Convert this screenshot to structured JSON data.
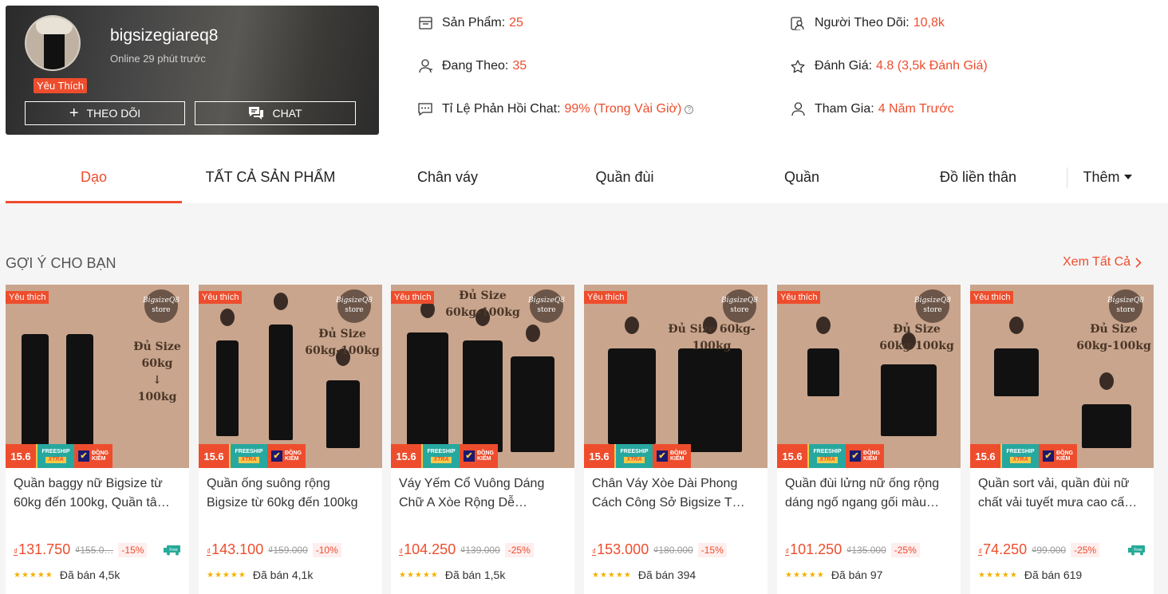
{
  "shop": {
    "name": "bigsizegiareq8",
    "online": "Online 29 phút trước",
    "badge": "Yêu Thích",
    "follow_label": "THEO DÕI",
    "chat_label": "CHAT"
  },
  "stats": {
    "products_label": "Sản Phẩm:",
    "products_value": "25",
    "following_label": "Đang Theo:",
    "following_value": "35",
    "response_label": "Tỉ Lệ Phản Hồi Chat:",
    "response_value": "99% (Trong Vài Giờ)",
    "followers_label": "Người Theo Dõi:",
    "followers_value": "10,8k",
    "rating_label": "Đánh Giá:",
    "rating_value": "4.8 (3,5k Đánh Giá)",
    "joined_label": "Tham Gia:",
    "joined_value": "4 Năm Trước"
  },
  "tabs": [
    {
      "label": "Dạo",
      "active": true
    },
    {
      "label": "TẤT CẢ SẢN PHẨM"
    },
    {
      "label": "Chân váy"
    },
    {
      "label": "Quần đùi"
    },
    {
      "label": "Quần"
    },
    {
      "label": "Đồ liền thân"
    },
    {
      "label": "Thêm"
    }
  ],
  "section": {
    "title": "GỢI Ý CHO BẠN",
    "see_all": "Xem Tất Cả"
  },
  "badges": {
    "fav": "Yêu thích",
    "sale": "15.6",
    "freeship_1": "FREESHIP",
    "freeship_2": "XTRA",
    "dongkiem_1": "ĐỒNG",
    "dongkiem_2": "KIỂM",
    "store_1": "BigsizeQ8",
    "store_2": "store",
    "free_icon": "Free"
  },
  "products": [
    {
      "line1": "Quần baggy nữ Bigsize từ",
      "line2": "60kg đến 100kg, Quần tâ…",
      "price": "131.750",
      "old": "₫155.0…",
      "discount": "-15%",
      "sold": "Đã bán 4,5k",
      "freeship": true,
      "img_text": "Đủ Size\n60kg\n↓\n100kg"
    },
    {
      "line1": "Quần ống suông rộng",
      "line2": "Bigsize từ 60kg đến 100kg",
      "price": "143.100",
      "old": "₫159.000",
      "discount": "-10%",
      "sold": "Đã bán 4,1k",
      "freeship": false,
      "img_text": "Đủ Size\n60kg-100kg"
    },
    {
      "line1": "Váy Yếm Cổ Vuông Dáng",
      "line2": "Chữ A Xòe Rộng Dễ…",
      "price": "104.250",
      "old": "₫139.000",
      "discount": "-25%",
      "sold": "Đã bán 1,5k",
      "freeship": false,
      "img_text": "Đủ Size\n60kg-100kg"
    },
    {
      "line1": "Chân Váy Xòe Dài Phong",
      "line2": "Cách Công Sở Bigsize T…",
      "price": "153.000",
      "old": "₫180.000",
      "discount": "-15%",
      "sold": "Đã bán 394",
      "freeship": false,
      "img_text": "Đủ Size 60kg-100kg"
    },
    {
      "line1": "Quần đùi lửng nữ ống rộng",
      "line2": "dáng ngố ngang gối màu…",
      "price": "101.250",
      "old": "₫135.000",
      "discount": "-25%",
      "sold": "Đã bán 97",
      "freeship": false,
      "img_text": "Đủ Size\n60kg-100kg"
    },
    {
      "line1": "Quần sort vải, quần đùi nữ",
      "line2": "chất vải tuyết mưa cao cấ…",
      "price": "74.250",
      "old": "₫99.000",
      "discount": "-25%",
      "sold": "Đã bán 619",
      "freeship": true,
      "img_text": "Đủ Size\n60kg-100kg"
    }
  ],
  "currency": "₫",
  "stars": "★★★★★",
  "colors": {
    "accent": "#ee4d2d",
    "star": "#f5b200"
  }
}
